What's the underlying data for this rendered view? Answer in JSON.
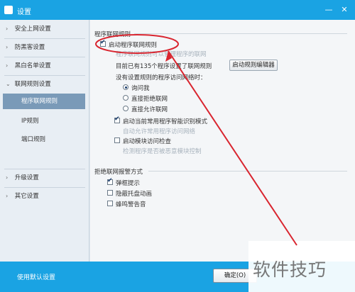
{
  "window": {
    "title": "设置"
  },
  "sidebar": {
    "items": [
      {
        "label": "安全上网设置",
        "chevron": "›"
      },
      {
        "label": "防黑客设置",
        "chevron": "›"
      },
      {
        "label": "黑白名单设置",
        "chevron": "›"
      },
      {
        "label": "联网规则设置",
        "chevron": "⌄"
      },
      {
        "label": "程序联网规则"
      },
      {
        "label": "IP规则"
      },
      {
        "label": "端口规则"
      },
      {
        "label": "升级设置",
        "chevron": "›"
      },
      {
        "label": "其它设置",
        "chevron": "›"
      }
    ]
  },
  "main": {
    "section1": {
      "title": "程序联网规则",
      "enable_label": "启动程序联网规则",
      "enable_hint": "程序联网规则可以管理程序的联网",
      "status_text": "目前已有135个程序设置了联网规则",
      "open_editor_button": "启动规则编辑器",
      "unset_prompt": "没有设置规则的程序访问网络时：",
      "options": [
        "询问我",
        "直接拒绝联网",
        "直接允许联网"
      ],
      "smart_label": "启动当前常用程序智能识别模式",
      "smart_hint": "自动允许常用程序访问网络",
      "module_label": "启动模块访问检查",
      "module_hint": "检测程序是否被恶意模块控制"
    },
    "section2": {
      "title": "拒绝联网报警方式",
      "options": [
        "弹框提示",
        "隐蔽托盘动画",
        "蜂鸣警告音"
      ]
    }
  },
  "footer": {
    "link": "使用默认设置",
    "ok_button": "确定(O)"
  },
  "watermark": {
    "text": "软件技巧"
  },
  "colors": {
    "titlebar": "#1aa3e3",
    "annotation": "#d9252f",
    "active_item": "#7a9ab8"
  }
}
